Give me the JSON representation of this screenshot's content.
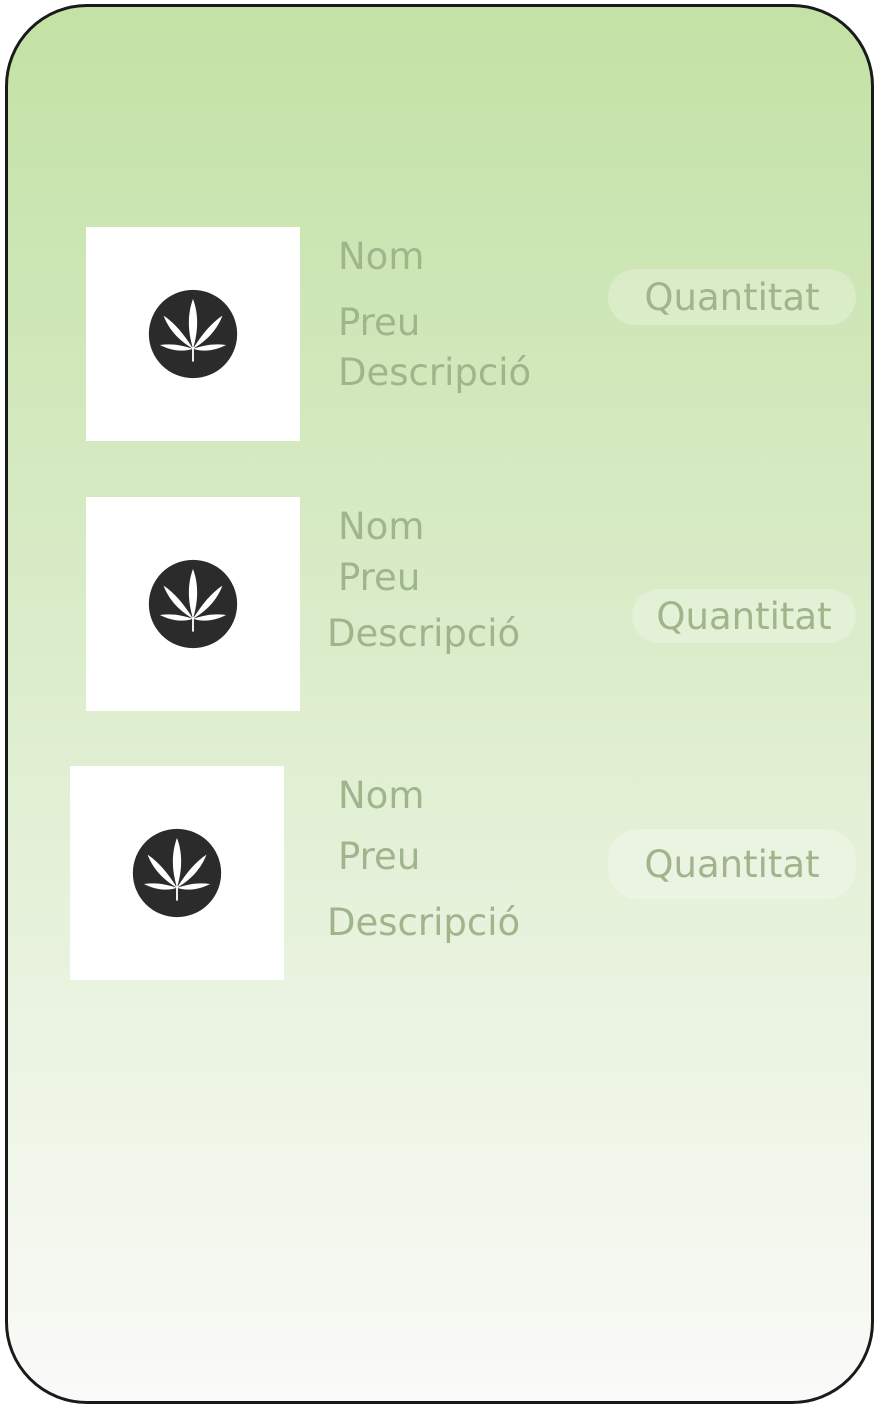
{
  "products": [
    {
      "name": "Nom",
      "price": "Preu",
      "description": "Descripció",
      "quantity": "Quantitat",
      "image_icon": "cannabis-leaf-icon"
    },
    {
      "name": "Nom",
      "price": "Preu",
      "description": "Descripció",
      "quantity": "Quantitat",
      "image_icon": "cannabis-leaf-icon"
    },
    {
      "name": "Nom",
      "price": "Preu",
      "description": "Descripció",
      "quantity": "Quantitat",
      "image_icon": "cannabis-leaf-icon"
    }
  ],
  "colors": {
    "gradient_top": "#c3e2a5",
    "gradient_bottom": "#fafaf8",
    "text": "#a0b58c",
    "icon": "#2b2b2b"
  }
}
